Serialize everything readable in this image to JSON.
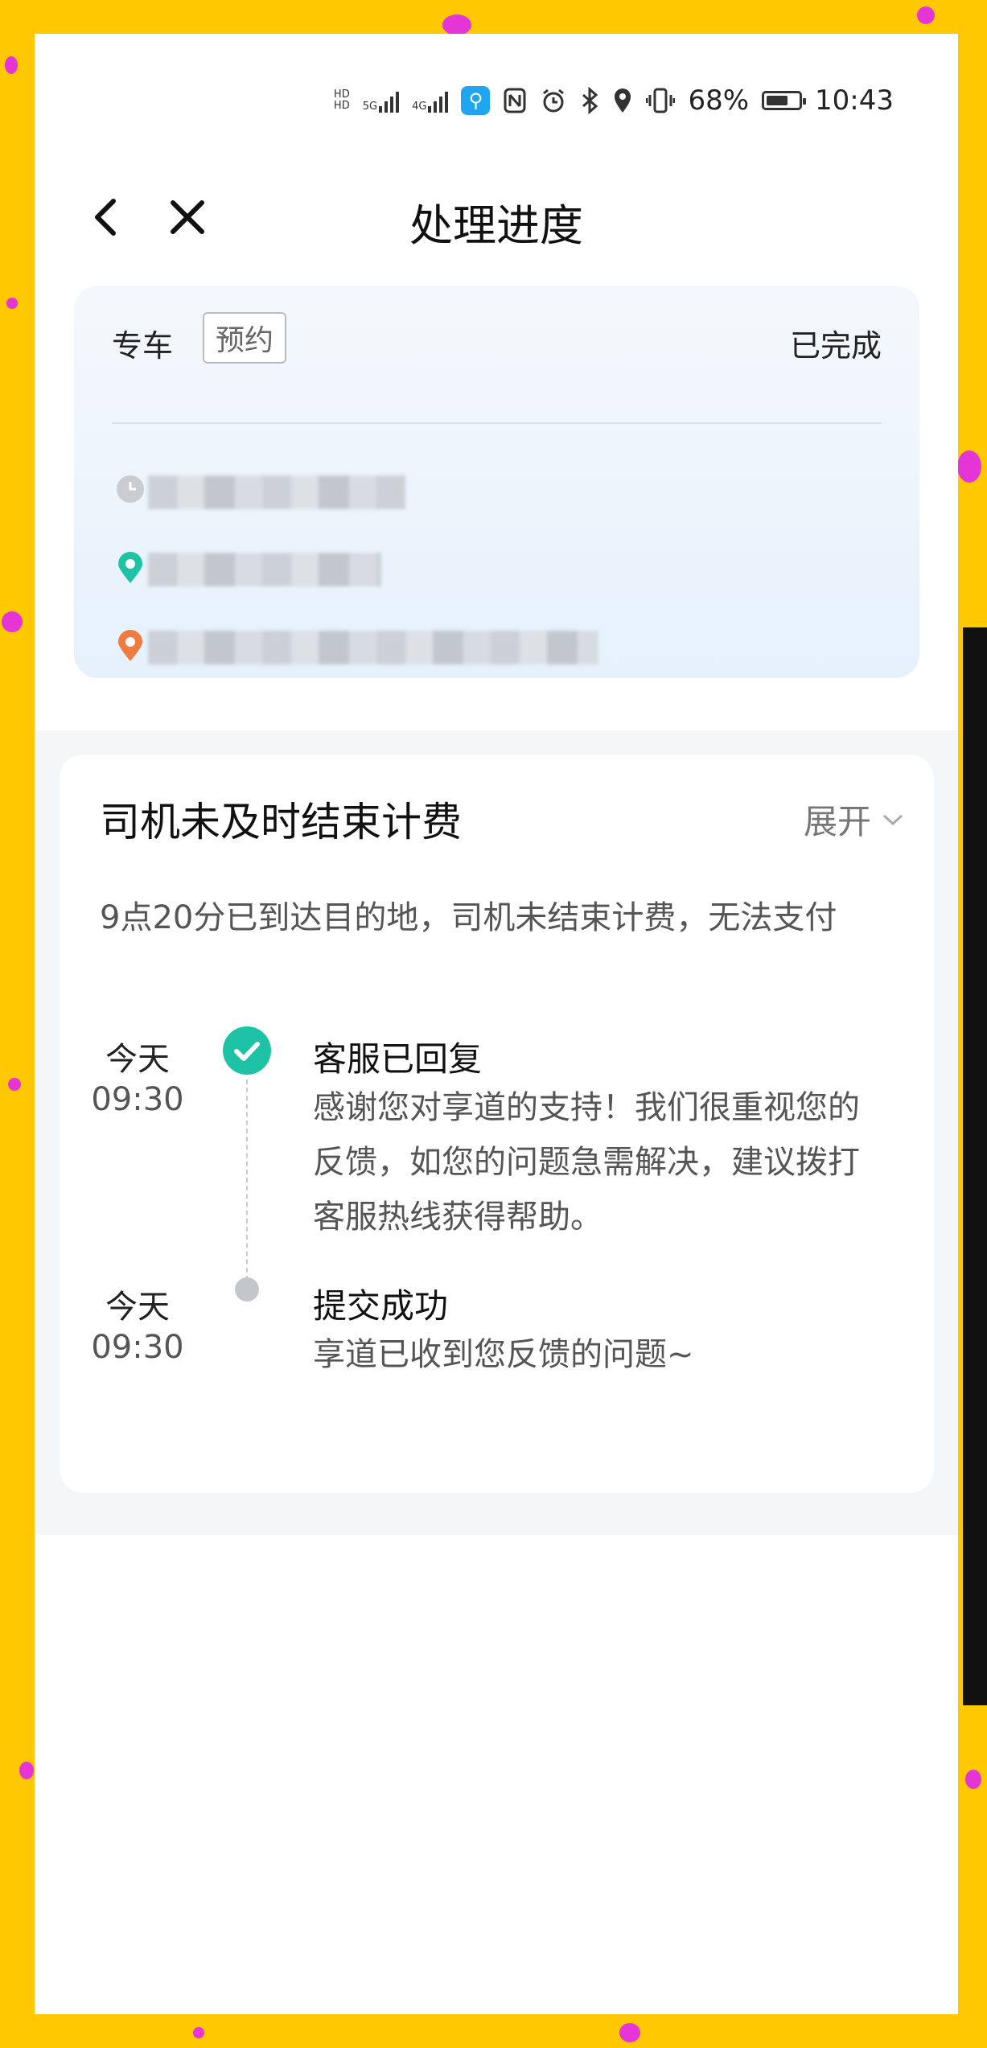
{
  "status_bar": {
    "hd_label_1": "HD",
    "hd_label_2": "HD",
    "net_5g": "5G",
    "net_4g": "4G",
    "battery_text": "68%",
    "battery_level": 0.68,
    "time": "10:43"
  },
  "header": {
    "title": "处理进度",
    "back_icon": "chevron-left-icon",
    "close_icon": "close-icon"
  },
  "order": {
    "car_type": "专车",
    "tag": "预约",
    "status": "已完成",
    "rows": [
      {
        "icon": "clock-icon",
        "color": "#C9CCD0"
      },
      {
        "icon": "pickup-pin-icon",
        "color": "#1EC3A6"
      },
      {
        "icon": "dropoff-pin-icon",
        "color": "#F07B3F"
      }
    ]
  },
  "issue": {
    "title": "司机未及时结束计费",
    "expand_label": "展开",
    "description": "9点20分已到达目的地，司机未结束计费，无法支付"
  },
  "timeline": [
    {
      "day": "今天",
      "time": "09:30",
      "title": "客服已回复",
      "body": "感谢您对享道的支持！我们很重视您的反馈，如您的问题急需解决，建议拨打客服热线获得帮助。"
    },
    {
      "day": "今天",
      "time": "09:30",
      "title": "提交成功",
      "body": "享道已收到您反馈的问题~"
    }
  ],
  "colors": {
    "accent": "#1EC3A6",
    "background": "#FFC800",
    "pink_dots": "#E535D6"
  }
}
